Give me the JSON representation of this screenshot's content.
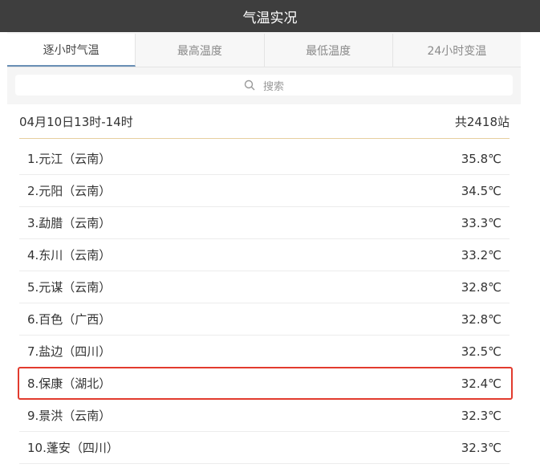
{
  "header": {
    "title": "气温实况"
  },
  "tabs": [
    {
      "label": "逐小时气温",
      "active": true
    },
    {
      "label": "最高温度",
      "active": false
    },
    {
      "label": "最低温度",
      "active": false
    },
    {
      "label": "24小时变温",
      "active": false
    }
  ],
  "search": {
    "label": "搜索",
    "icon": "search-icon"
  },
  "summary": {
    "time_range": "04月10日13时-14时",
    "station_count": "共2418站"
  },
  "stations": [
    {
      "name": "1.元江（云南）",
      "temp": "35.8℃"
    },
    {
      "name": "2.元阳（云南）",
      "temp": "34.5℃"
    },
    {
      "name": "3.勐腊（云南）",
      "temp": "33.3℃"
    },
    {
      "name": "4.东川（云南）",
      "temp": "33.2℃"
    },
    {
      "name": "5.元谋（云南）",
      "temp": "32.8℃"
    },
    {
      "name": "6.百色（广西）",
      "temp": "32.8℃"
    },
    {
      "name": "7.盐边（四川）",
      "temp": "32.5℃"
    },
    {
      "name": "8.保康（湖北）",
      "temp": "32.4℃",
      "highlighted": true
    },
    {
      "name": "9.景洪（云南）",
      "temp": "32.3℃"
    },
    {
      "name": "10.蓬安（四川）",
      "temp": "32.3℃"
    }
  ],
  "colors": {
    "header_bg": "#3e3e3e",
    "highlight_border": "#e23b2e",
    "summary_divider": "#e6cf9f"
  }
}
